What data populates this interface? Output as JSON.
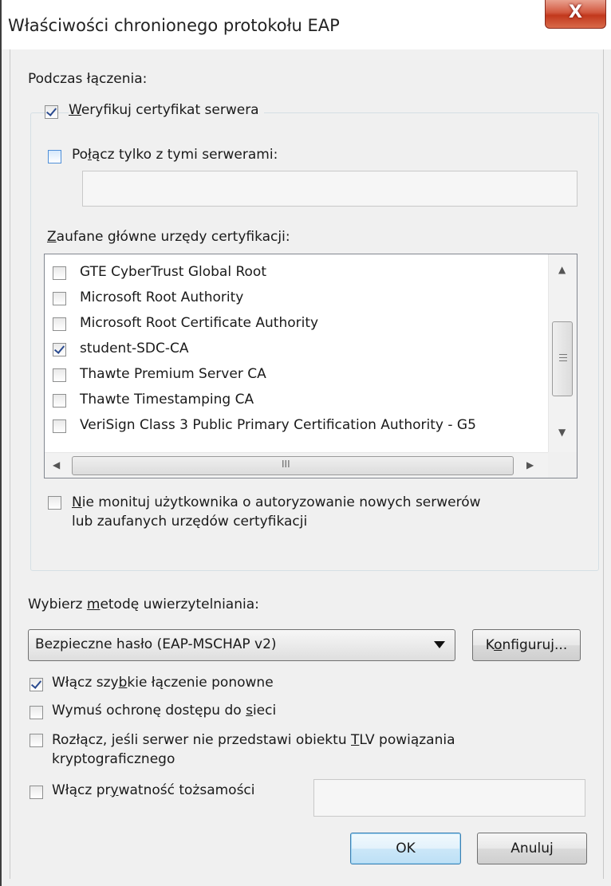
{
  "window": {
    "title": "Właściwości chronionego protokołu EAP",
    "close_label": "X"
  },
  "connect_section": {
    "heading": "Podczas łączenia:",
    "verify_cert": {
      "label_pre": "",
      "label_u": "W",
      "label_post": "eryfikuj certyfikat serwera",
      "checked": true
    },
    "connect_only": {
      "label_pre": "Po",
      "label_u": "ł",
      "label_post": "ącz tylko z tymi serwerami:",
      "checked": false,
      "value": ""
    },
    "trusted_ca_label": {
      "label_pre": "",
      "label_u": "Z",
      "label_post": "aufane główne urzędy certyfikacji:"
    },
    "ca_list": [
      {
        "name": "GTE CyberTrust Global Root",
        "checked": false
      },
      {
        "name": "Microsoft Root Authority",
        "checked": false
      },
      {
        "name": "Microsoft Root Certificate Authority",
        "checked": false
      },
      {
        "name": "student-SDC-CA",
        "checked": true
      },
      {
        "name": "Thawte Premium Server CA",
        "checked": false
      },
      {
        "name": "Thawte Timestamping CA",
        "checked": false
      },
      {
        "name": "VeriSign Class 3 Public Primary Certification Authority - G5",
        "checked": false
      }
    ],
    "no_prompt": {
      "line1_pre": "",
      "line1_u": "N",
      "line1_post": "ie monituj użytkownika o autoryzowanie nowych serwerów",
      "line2": "lub zaufanych urzędów certyfikacji",
      "checked": false
    }
  },
  "auth_section": {
    "label_pre": "Wybierz ",
    "label_u": "m",
    "label_post": "etodę uwierzytelniania:",
    "method_selected": "Bezpieczne hasło (EAP-MSCHAP v2)",
    "configure_pre": "K",
    "configure_u": "o",
    "configure_post": "nfiguruj...",
    "fast_reconnect": {
      "pre": "Włącz szy",
      "u": "b",
      "post": "kie łączenie ponowne",
      "checked": true
    },
    "nap": {
      "pre": "Wymuś ochronę dostępu do ",
      "u": "s",
      "post": "ieci",
      "checked": false
    },
    "tlv": {
      "pre": "Rozłącz, jeśli serwer nie przedstawi obiektu ",
      "u": "T",
      "post": "LV powiązania",
      "line2": "kryptograficznego",
      "checked": false
    },
    "identity_privacy": {
      "pre": "Włącz pr",
      "u": "y",
      "post": "watność tożsamości",
      "checked": false,
      "value": ""
    }
  },
  "buttons": {
    "ok": "OK",
    "cancel": "Anuluj"
  },
  "scrollbar_icons": {
    "up": "scroll-up-arrow",
    "down": "scroll-down-arrow",
    "left": "scroll-left-arrow",
    "right": "scroll-right-arrow",
    "grip_v": "≡",
    "grip_h": "III"
  },
  "colors": {
    "close_button": "#c2381d",
    "default_button": "#3c7fb1"
  }
}
